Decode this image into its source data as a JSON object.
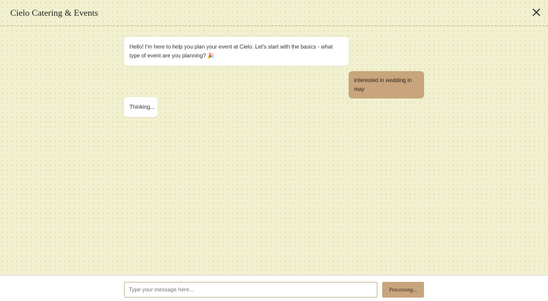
{
  "header": {
    "title": "Cielo Catering & Events",
    "close_icon": "close-icon"
  },
  "messages": [
    {
      "role": "bot",
      "text": "Hello! I'm here to help you plan your event at Cielo. Let's start with the basics - what type of event are you planning? 🎉"
    },
    {
      "role": "user",
      "text": "interested in wedding in may"
    },
    {
      "role": "bot",
      "text": "Thinking..."
    }
  ],
  "composer": {
    "placeholder": "Type your message here...",
    "value": "",
    "send_label": "Processing..."
  },
  "colors": {
    "background": "#f1f0cf",
    "accent": "#c8a57c",
    "bot_bubble": "#ffffff"
  }
}
